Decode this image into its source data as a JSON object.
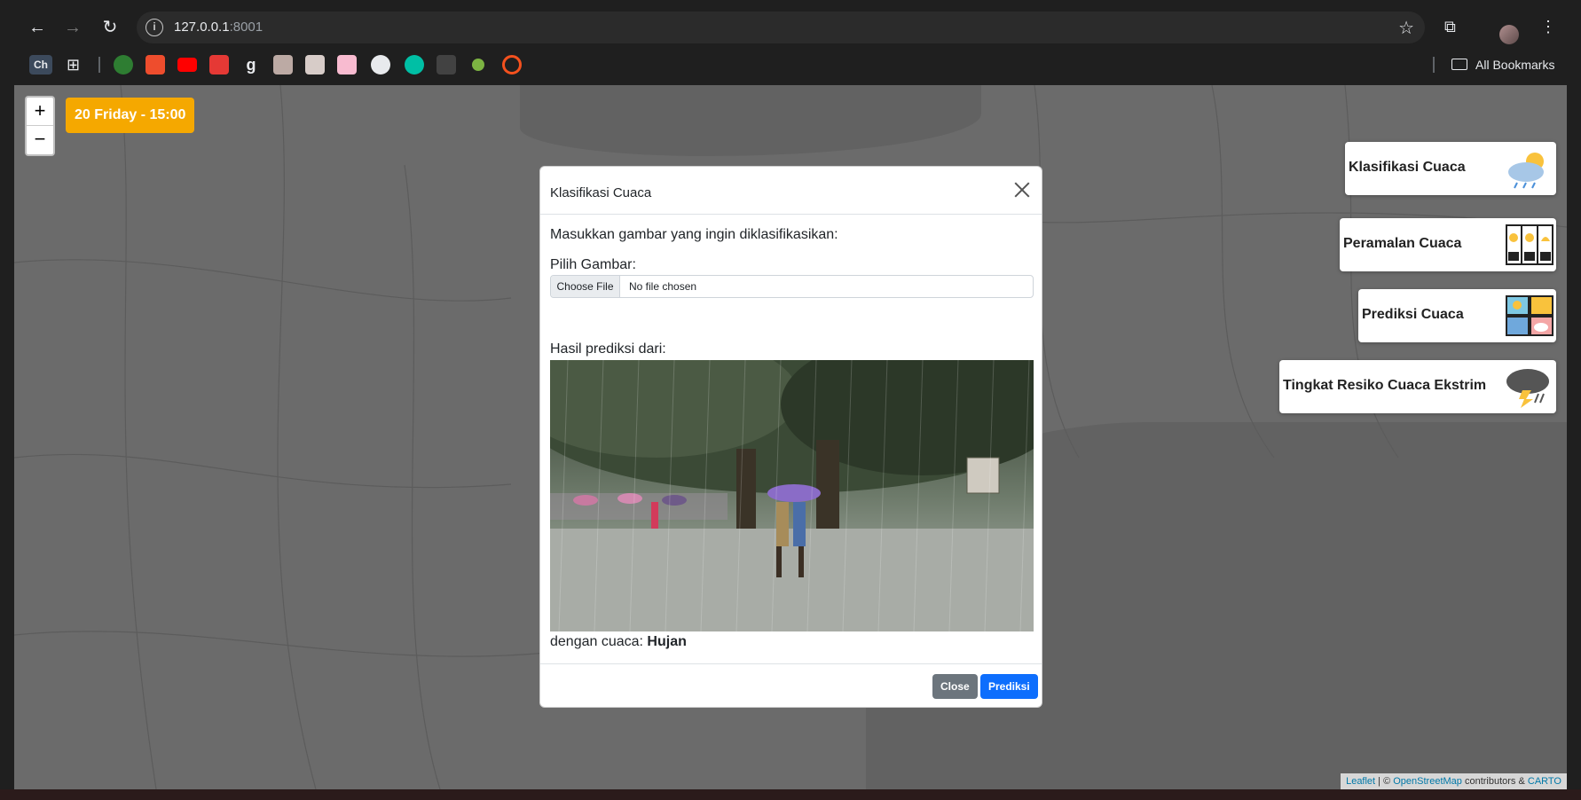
{
  "browser": {
    "url_host": "127.0.0.1",
    "url_port": ":8001",
    "bookmarks_folder_label": "All Bookmarks",
    "bookmark_ch_label": "Ch",
    "icons": [
      "back-icon",
      "forward-icon",
      "reload-icon",
      "info-icon",
      "star-icon",
      "extensions-icon",
      "menu-icon"
    ]
  },
  "map": {
    "date_badge": "20 Friday - 15:00",
    "zoom_in": "+",
    "zoom_out": "−",
    "attribution": {
      "leaflet": "Leaflet",
      "sep": " | © ",
      "osm": "OpenStreetMap",
      "contrib": " contributors & ",
      "carto": "CARTO"
    }
  },
  "menu": {
    "items": [
      {
        "label": "Klasifikasi Cuaca",
        "icon": "cloud-sun-rain-icon"
      },
      {
        "label": "Peramalan Cuaca",
        "icon": "forecast-calendar-icon"
      },
      {
        "label": "Prediksi Cuaca",
        "icon": "weather-grid-icon"
      },
      {
        "label": "Tingkat Resiko Cuaca Ekstrim",
        "icon": "storm-lightning-icon"
      }
    ]
  },
  "modal": {
    "title": "Klasifikasi Cuaca",
    "lead": "Masukkan gambar yang ingin diklasifikasikan:",
    "file_label": "Pilih Gambar:",
    "file_button": "Choose File",
    "file_status": "No file chosen",
    "result_label": "Hasil prediksi dari:",
    "result_prefix": "dengan cuaca: ",
    "result_value": "Hujan",
    "close_button": "Close",
    "predict_button": "Prediksi"
  },
  "colors": {
    "badge": "#f5a800",
    "primary": "#0d6efd",
    "secondary": "#6c757d"
  }
}
